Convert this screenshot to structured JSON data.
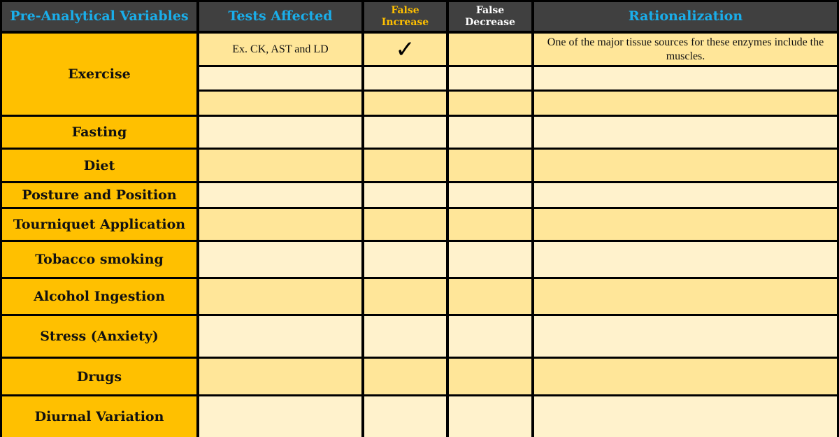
{
  "header": {
    "variables": "Pre-Analytical Variables",
    "tests": "Tests Affected",
    "false_increase": "False Increase",
    "false_decrease": "False Decrease",
    "rationalization": "Rationalization"
  },
  "colors": {
    "header_bg": "#404040",
    "header_text_blue": "#1AAEEA",
    "header_text_gold": "#FFC000",
    "header_text_white": "#FFFFFF",
    "variable_bg": "#FFC000",
    "row_dark": "#FFE699",
    "row_light": "#FFF2CC",
    "grid_line": "#000000"
  },
  "variables": [
    {
      "label": "Exercise",
      "rows": [
        {
          "tests": "Ex. CK, AST and LD",
          "false_increase": "✓",
          "false_decrease": "",
          "rationalization": "One of the major tissue sources for these enzymes include the muscles."
        },
        {
          "tests": "",
          "false_increase": "",
          "false_decrease": "",
          "rationalization": ""
        },
        {
          "tests": "",
          "false_increase": "",
          "false_decrease": "",
          "rationalization": ""
        }
      ]
    },
    {
      "label": "Fasting",
      "rows": [
        {
          "tests": "",
          "false_increase": "",
          "false_decrease": "",
          "rationalization": ""
        }
      ]
    },
    {
      "label": "Diet",
      "rows": [
        {
          "tests": "",
          "false_increase": "",
          "false_decrease": "",
          "rationalization": ""
        }
      ]
    },
    {
      "label": "Posture and Position",
      "rows": [
        {
          "tests": "",
          "false_increase": "",
          "false_decrease": "",
          "rationalization": ""
        }
      ]
    },
    {
      "label": "Tourniquet Application",
      "rows": [
        {
          "tests": "",
          "false_increase": "",
          "false_decrease": "",
          "rationalization": ""
        }
      ]
    },
    {
      "label": "Tobacco smoking",
      "rows": [
        {
          "tests": "",
          "false_increase": "",
          "false_decrease": "",
          "rationalization": ""
        }
      ]
    },
    {
      "label": "Alcohol Ingestion",
      "rows": [
        {
          "tests": "",
          "false_increase": "",
          "false_decrease": "",
          "rationalization": ""
        }
      ]
    },
    {
      "label": "Stress (Anxiety)",
      "rows": [
        {
          "tests": "",
          "false_increase": "",
          "false_decrease": "",
          "rationalization": ""
        }
      ]
    },
    {
      "label": "Drugs",
      "rows": [
        {
          "tests": "",
          "false_increase": "",
          "false_decrease": "",
          "rationalization": ""
        }
      ]
    },
    {
      "label": "Diurnal Variation",
      "rows": [
        {
          "tests": "",
          "false_increase": "",
          "false_decrease": "",
          "rationalization": ""
        }
      ]
    }
  ]
}
